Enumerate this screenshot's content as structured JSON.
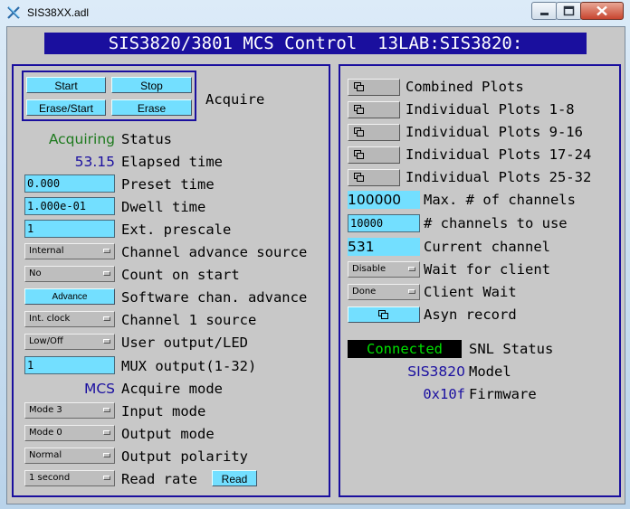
{
  "window": {
    "title": "SIS38XX.adl"
  },
  "banner": "SIS3820/3801 MCS Control  13LAB:SIS3820:",
  "colors": {
    "banner_bg": "#1a0f9e",
    "control_cyan": "#73dfff",
    "acquiring_green": "#1e7a1e",
    "value_blue": "#1a0fa0",
    "connected_bg": "#000000",
    "connected_fg": "#00e000"
  },
  "acquire": {
    "start": "Start",
    "stop": "Stop",
    "erase_start": "Erase/Start",
    "erase": "Erase",
    "label": "Acquire"
  },
  "left": {
    "status_value": "Acquiring",
    "status_label": "Status",
    "elapsed_value": "53.15",
    "elapsed_label": "Elapsed time",
    "preset_value": "0.000",
    "preset_label": "Preset time",
    "dwell_value": "1.000e-01",
    "dwell_label": "Dwell time",
    "prescale_value": "1",
    "prescale_label": "Ext. prescale",
    "advance_source_value": "Internal",
    "advance_source_label": "Channel advance source",
    "count_on_start_value": "No",
    "count_on_start_label": "Count on start",
    "software_advance_button": "Advance",
    "software_advance_label": "Software chan. advance",
    "ch1_source_value": "Int. clock",
    "ch1_source_label": "Channel 1 source",
    "user_output_value": "Low/Off",
    "user_output_label": "User output/LED",
    "mux_value": "1",
    "mux_label": "MUX output(1-32)",
    "acquire_mode_value": "MCS",
    "acquire_mode_label": "Acquire mode",
    "input_mode_value": "Mode 3",
    "input_mode_label": "Input mode",
    "output_mode_value": "Mode 0",
    "output_mode_label": "Output mode",
    "output_polarity_value": "Normal",
    "output_polarity_label": "Output polarity",
    "read_rate_value": "1 second",
    "read_rate_label": "Read rate",
    "read_button": "Read"
  },
  "right": {
    "combined_plots": "Combined Plots",
    "plots_1_8": "Individual Plots 1-8",
    "plots_9_16": "Individual Plots 9-16",
    "plots_17_24": "Individual Plots 17-24",
    "plots_25_32": "Individual Plots 25-32",
    "max_channels_value": "100000",
    "max_channels_label": "Max. # of channels",
    "channels_to_use_value": "10000",
    "channels_to_use_label": "# channels to use",
    "current_channel_value": "531",
    "current_channel_label": "Current channel",
    "wait_for_client_value": "Disable",
    "wait_for_client_label": "Wait for client",
    "client_wait_value": "Done",
    "client_wait_label": "Client Wait",
    "asyn_label": "Asyn record",
    "snl_value": "Connected",
    "snl_label": "SNL Status",
    "model_value": "SIS3820",
    "model_label": "Model",
    "firmware_value": "0x10f",
    "firmware_label": "Firmware"
  }
}
